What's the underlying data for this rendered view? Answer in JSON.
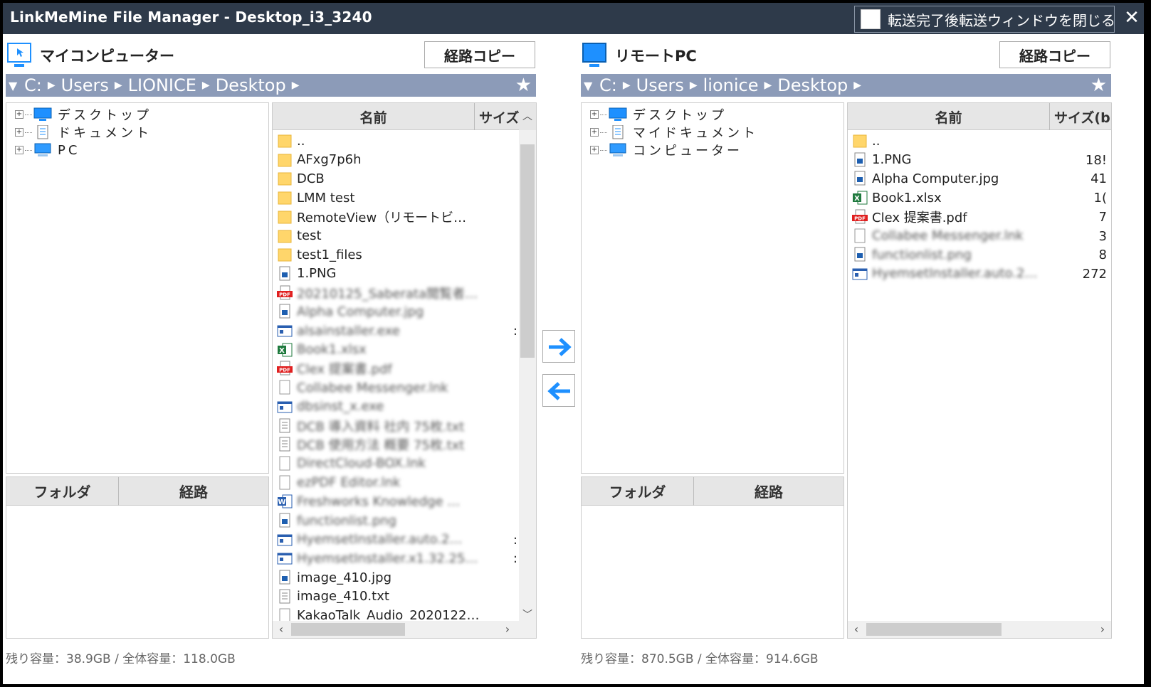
{
  "window": {
    "title": "LinkMeMine File Manager - Desktop_i3_3240",
    "close_option_label": "転送完了後転送ウィンドウを閉じる",
    "close_icon": "✕"
  },
  "left": {
    "title": "マイコンピューター",
    "copy_path_label": "経路コピー",
    "breadcrumb": [
      "C:",
      "Users",
      "LIONICE",
      "Desktop"
    ],
    "tree": [
      {
        "label": "デスクトップ",
        "icon": "desktop-icon"
      },
      {
        "label": "ドキュメント",
        "icon": "document-icon"
      },
      {
        "label": "PC",
        "icon": "computer-icon"
      }
    ],
    "folder_header": "フォルダ",
    "path_header": "経路",
    "columns": {
      "name": "名前",
      "size": "サイズ"
    },
    "files": [
      {
        "name": "..",
        "icon": "folder"
      },
      {
        "name": "AFxg7p6h",
        "icon": "folder"
      },
      {
        "name": "DCB",
        "icon": "folder"
      },
      {
        "name": "LMM test",
        "icon": "folder"
      },
      {
        "name": "RemoteView（リモートビ…",
        "icon": "folder"
      },
      {
        "name": "test",
        "icon": "folder"
      },
      {
        "name": "test1_files",
        "icon": "folder"
      },
      {
        "name": "1.PNG",
        "icon": "image"
      },
      {
        "name": "20210125_Saberata閲覧者…",
        "icon": "pdf",
        "blur": true
      },
      {
        "name": "Alpha Computer.jpg",
        "icon": "image",
        "blur": true
      },
      {
        "name": "alsainstaller.exe",
        "icon": "exe",
        "blur": true
      },
      {
        "name": "Book1.xlsx",
        "icon": "excel",
        "blur": true
      },
      {
        "name": "Clex 提案書.pdf",
        "icon": "pdf",
        "blur": true
      },
      {
        "name": "Collabee Messenger.lnk",
        "icon": "blank",
        "blur": true
      },
      {
        "name": "dbsinst_x.exe",
        "icon": "exe",
        "blur": true
      },
      {
        "name": "DCB 導入資料 社内 75枚.txt",
        "icon": "text",
        "blur": true
      },
      {
        "name": "DCB 使用方法 概要 75枚.txt",
        "icon": "text",
        "blur": true
      },
      {
        "name": "DirectCloud-BOX.lnk",
        "icon": "blank",
        "blur": true
      },
      {
        "name": "ezPDF Editor.lnk",
        "icon": "blank",
        "blur": true
      },
      {
        "name": "Freshworks Knowledge …",
        "icon": "word",
        "blur": true
      },
      {
        "name": "functionlist.png",
        "icon": "image",
        "blur": true
      },
      {
        "name": "HyemsetInstaller.auto.2…",
        "icon": "exe",
        "blur": true
      },
      {
        "name": "HyemsetInstaller.x1.32.25…",
        "icon": "exe",
        "blur": true
      },
      {
        "name": "image_410.jpg",
        "icon": "image"
      },
      {
        "name": "image_410.txt",
        "icon": "text"
      },
      {
        "name": "KakaoTalk_Audio_2020122…",
        "icon": "blank"
      }
    ],
    "sizes": [
      {
        "row": 10,
        "text": ":"
      },
      {
        "row": 21,
        "text": ":"
      },
      {
        "row": 22,
        "text": ":"
      }
    ],
    "status": "残り容量：38.9GB / 全体容量：118.0GB"
  },
  "right": {
    "title": "リモートPC",
    "copy_path_label": "経路コピー",
    "breadcrumb": [
      "C:",
      "Users",
      "lionice",
      "Desktop"
    ],
    "tree": [
      {
        "label": "デスクトップ",
        "icon": "desktop-icon"
      },
      {
        "label": "マイドキュメント",
        "icon": "document-icon"
      },
      {
        "label": "コンピューター",
        "icon": "computer-icon"
      }
    ],
    "folder_header": "フォルダ",
    "path_header": "経路",
    "columns": {
      "name": "名前",
      "size": "サイズ(b"
    },
    "files": [
      {
        "name": "..",
        "icon": "folder",
        "size": ""
      },
      {
        "name": "1.PNG",
        "icon": "image",
        "size": "18!"
      },
      {
        "name": "Alpha Computer.jpg",
        "icon": "image",
        "size": "41"
      },
      {
        "name": "Book1.xlsx",
        "icon": "excel",
        "size": "1("
      },
      {
        "name": "Clex 提案書.pdf",
        "icon": "pdf",
        "size": "7"
      },
      {
        "name": "Collabee Messenger.lnk",
        "icon": "blank",
        "size": "3",
        "blur": true
      },
      {
        "name": "functionlist.png",
        "icon": "image",
        "size": "8",
        "blur": true
      },
      {
        "name": "HyemsetInstaller.auto.2…",
        "icon": "exe",
        "size": "272",
        "blur": true
      }
    ],
    "status": "残り容量：870.5GB / 全体容量：914.6GB"
  },
  "transfer": {
    "to_remote_icon": "arrow-right-icon",
    "to_local_icon": "arrow-left-icon"
  },
  "colors": {
    "titlebar": "#2e3a4a",
    "breadcrumb": "#8c9bb8",
    "accent": "#1e90ff"
  }
}
